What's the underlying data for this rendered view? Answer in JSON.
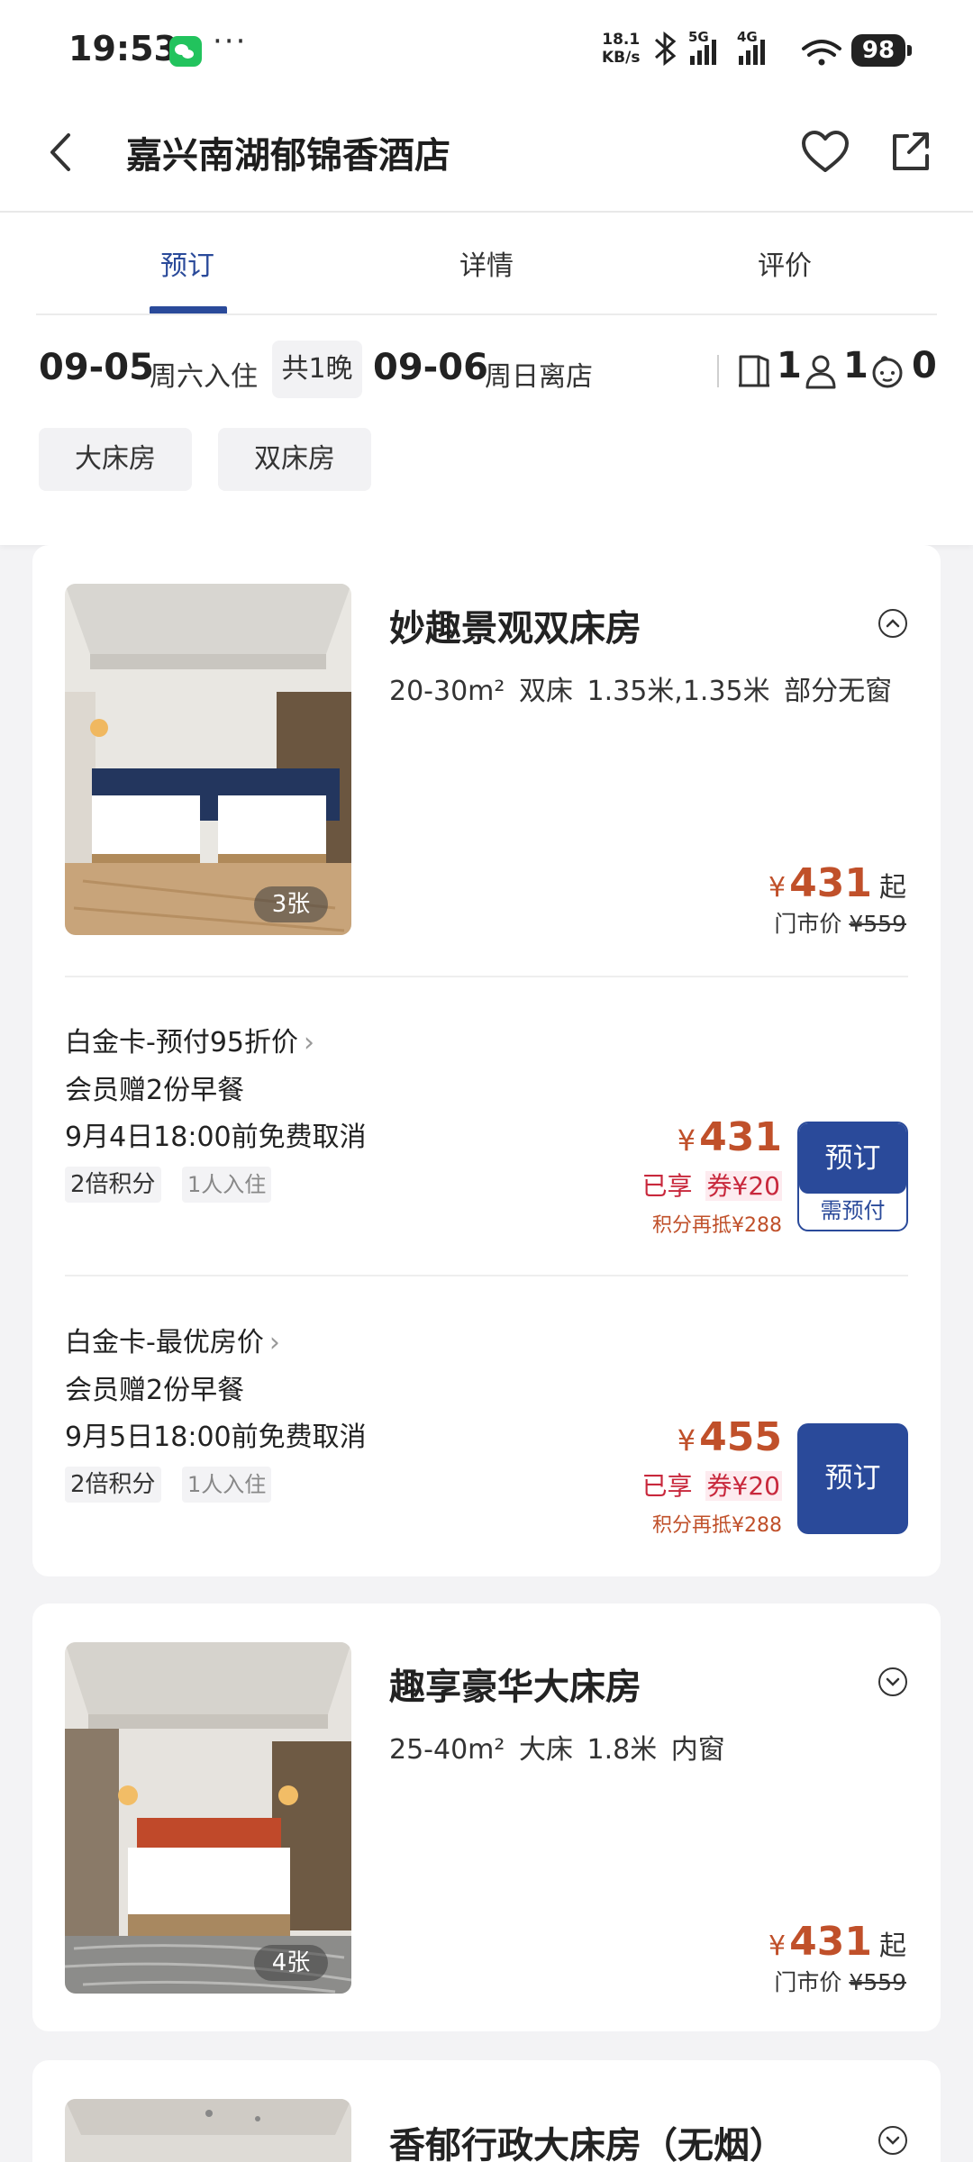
{
  "status_bar": {
    "time": "19:53",
    "more": "···",
    "net_speed_value": "18.1",
    "net_speed_unit": "KB/s",
    "sig1_label": "5G",
    "sig2_label": "4G",
    "battery": "98",
    "colors": {
      "wechat": "#22c35d"
    }
  },
  "header": {
    "title": "嘉兴南湖郁锦香酒店",
    "icons": [
      "chevron-left-icon",
      "heart-icon",
      "share-icon"
    ]
  },
  "tabs": [
    "预订",
    "详情",
    "评价"
  ],
  "active_tab": 0,
  "booking": {
    "checkin_date": "09-05",
    "checkin_label": "周六入住",
    "nights": "共1晚",
    "checkout_date": "09-06",
    "checkout_label": "周日离店",
    "rooms": "1",
    "adults": "1",
    "children": "0"
  },
  "filters": [
    "大床房",
    "双床房"
  ],
  "rooms": [
    {
      "name": "妙趣景观双床房",
      "meta": "20-30m² 双床 1.35米,1.35米 部分无窗",
      "photos": "3张",
      "yen": "¥",
      "price": "431",
      "from": "起",
      "market_label": "门市价",
      "market_price": "¥559",
      "plans": [
        {
          "title": "白金卡-预付95折价",
          "breakfast": "会员赠2份早餐",
          "cancel": "9月4日18:00前免费取消",
          "tag1": "2倍积分",
          "tag2": "1人入住",
          "yen": "¥",
          "price": "431",
          "enjoy": "已享",
          "coupon": "券¥20",
          "points": "积分再抵¥288",
          "book": "预订",
          "prepay": "需预付"
        },
        {
          "title": "白金卡-最优房价",
          "breakfast": "会员赠2份早餐",
          "cancel": "9月5日18:00前免费取消",
          "tag1": "2倍积分",
          "tag2": "1人入住",
          "yen": "¥",
          "price": "455",
          "enjoy": "已享",
          "coupon": "券¥20",
          "points": "积分再抵¥288",
          "book": "预订"
        }
      ]
    },
    {
      "name": "趣享豪华大床房",
      "meta": "25-40m² 大床 1.8米 内窗",
      "photos": "4张",
      "yen": "¥",
      "price": "431",
      "from": "起",
      "market_label": "门市价",
      "market_price": "¥559"
    },
    {
      "name": "香郁行政大床房（无烟）"
    }
  ],
  "colors": {
    "brand": "#2a4a9a",
    "price": "#c0502a",
    "discount": "#c8283c"
  }
}
